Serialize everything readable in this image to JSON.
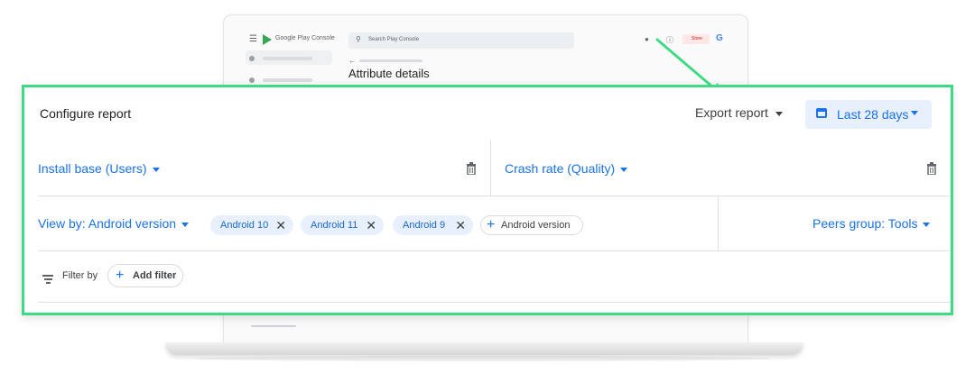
{
  "console": {
    "brand": "Google Play Console",
    "search_placeholder": "Search Play Console",
    "store_chip": "Store",
    "page_title": "Attribute details"
  },
  "report": {
    "title": "Configure report",
    "export_label": "Export report",
    "date_range": "Last 28 days",
    "metric_left": "Install base (Users)",
    "metric_right": "Crash rate (Quality)",
    "view_by": "View by: Android version",
    "filter_chips": [
      "Android 10",
      "Android 11",
      "Android 9"
    ],
    "add_dimension": "Android version",
    "peers_group": "Peers group: Tools",
    "filter_by_label": "Filter by",
    "add_filter_label": "Add filter"
  },
  "icons": {
    "hamburger": "menu-icon",
    "search": "search-icon",
    "help": "help-icon",
    "calendar": "calendar-icon",
    "trash": "delete-icon",
    "filter": "filter-icon",
    "close": "close-icon",
    "add": "plus-icon"
  },
  "colors": {
    "highlight_border": "#3ddc84",
    "arrow": "#3ddc84",
    "accent_blue": "#1a73e8",
    "chip_bg": "#e8f0fe"
  }
}
